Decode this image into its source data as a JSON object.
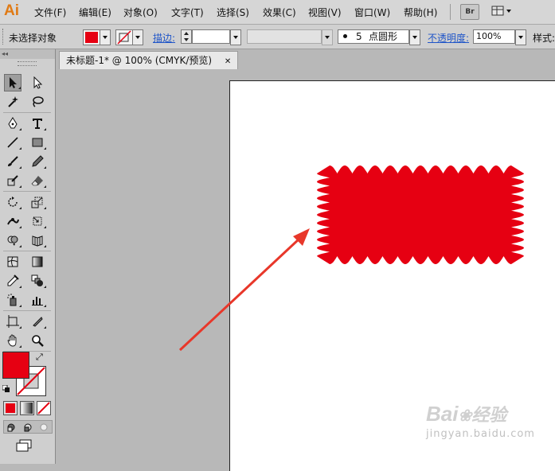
{
  "app": {
    "logo": "Ai"
  },
  "menu": {
    "items": [
      "文件(F)",
      "编辑(E)",
      "对象(O)",
      "文字(T)",
      "选择(S)",
      "效果(C)",
      "视图(V)",
      "窗口(W)",
      "帮助(H)"
    ],
    "bridge_label": "Br"
  },
  "control_bar": {
    "selection_status": "未选择对象",
    "fill_color": "#e60012",
    "stroke_label": "描边:",
    "brush_size": "5",
    "brush_shape": "点圆形",
    "opacity_label": "不透明度:",
    "opacity_value": "100%",
    "style_label": "样式:"
  },
  "document": {
    "tab_title": "未标题-1* @ 100% (CMYK/预览)",
    "close_glyph": "✕"
  },
  "toolbox": {
    "collapse_glyph": "◂◂",
    "fill_color": "#e60012",
    "stroke_color": "none",
    "tools": [
      "selection",
      "direct-selection",
      "magic-wand",
      "lasso",
      "pen",
      "type",
      "line",
      "rectangle",
      "paintbrush",
      "pencil",
      "blob-brush",
      "eraser",
      "rotate",
      "scale",
      "width",
      "free-transform",
      "shape-builder",
      "perspective-grid",
      "mesh",
      "gradient",
      "eyedropper",
      "blend",
      "symbol-sprayer",
      "column-graph",
      "artboard",
      "slice",
      "hand",
      "zoom"
    ]
  },
  "artwork": {
    "shape_color": "#e60012",
    "arrow_color": "#e8372a"
  },
  "watermark": {
    "brand": "Bai",
    "brand_suffix": "经验",
    "url": "jingyan.baidu.com"
  }
}
